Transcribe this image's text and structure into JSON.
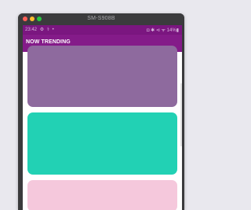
{
  "window": {
    "title": "SM-S908B"
  },
  "statusbar": {
    "time": "23:42",
    "left_icons": [
      "⚙",
      "⚕",
      "•"
    ],
    "right_text": "◘ ✱ ⊲ ᯤ 14%▮"
  },
  "appbar": {
    "title": "NOW TRENDING"
  },
  "cards": [
    {
      "color": "#8e6a9e"
    },
    {
      "color": "#22d1b4"
    },
    {
      "color": "#f5c8dc"
    }
  ]
}
